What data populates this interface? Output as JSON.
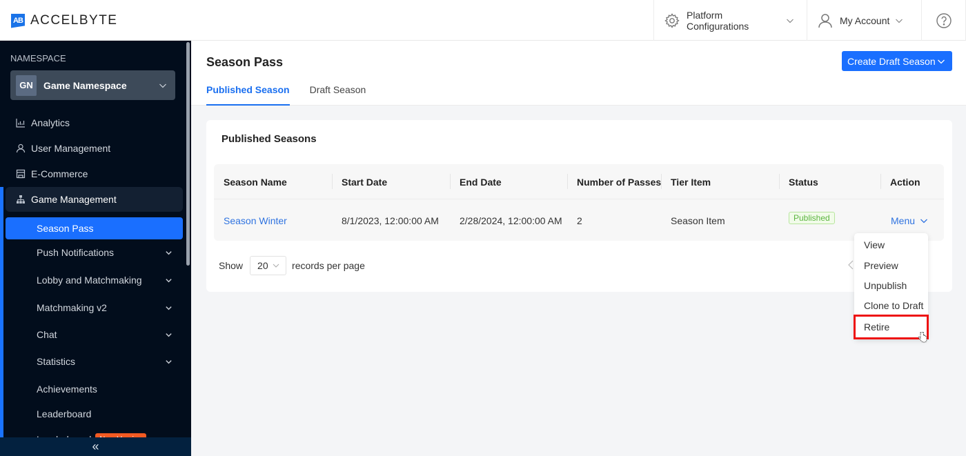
{
  "header": {
    "logo_mark": "AB",
    "logo_text": "ACCELBYTE",
    "platform_config_label": "Platform Configurations",
    "my_account_label": "My Account",
    "help_icon": "question-circle-icon"
  },
  "sidebar": {
    "namespace_label": "NAMESPACE",
    "namespace_avatar": "GN",
    "namespace_name": "Game Namespace",
    "top_items": [
      {
        "label": "Analytics",
        "icon": "bar-chart-icon"
      },
      {
        "label": "User Management",
        "icon": "user-icon"
      },
      {
        "label": "E-Commerce",
        "icon": "store-icon"
      },
      {
        "label": "Game Management",
        "icon": "hierarchy-icon"
      }
    ],
    "active_item": "Season Pass",
    "sub_items": [
      {
        "label": "Push Notifications",
        "expandable": true
      },
      {
        "label": "Lobby and Matchmaking",
        "expandable": true
      },
      {
        "label": "Matchmaking v2",
        "expandable": true
      },
      {
        "label": "Chat",
        "expandable": true
      },
      {
        "label": "Statistics",
        "expandable": true
      },
      {
        "label": "Achievements",
        "expandable": false
      },
      {
        "label": "Leaderboard",
        "expandable": false
      },
      {
        "label": "Leaderboard",
        "expandable": false,
        "badge": "New Version"
      }
    ],
    "collapse_icon": "double-chevron-left-icon"
  },
  "main": {
    "page_title": "Season Pass",
    "tabs": [
      {
        "label": "Published Season",
        "active": true
      },
      {
        "label": "Draft Season",
        "active": false
      }
    ],
    "create_button_label": "Create Draft Season",
    "card_title": "Published Seasons",
    "table": {
      "columns": [
        "Season Name",
        "Start Date",
        "End Date",
        "Number of Passes",
        "Tier Item",
        "Status",
        "Action"
      ],
      "rows": [
        {
          "season_name": "Season Winter",
          "start_date": "8/1/2023, 12:00:00 AM",
          "end_date": "2/28/2024, 12:00:00 AM",
          "number_of_passes": "2",
          "tier_item": "Season Item",
          "status": "Published",
          "action": "Menu"
        }
      ]
    },
    "pagination": {
      "show_label": "Show",
      "page_size": "20",
      "records_label": "records per page"
    },
    "action_menu": {
      "items": [
        "View",
        "Preview",
        "Unpublish",
        "Clone to Draft",
        "Retire"
      ],
      "highlighted": "Retire"
    }
  },
  "colors": {
    "accent": "#1a6fff",
    "sidebar_bg": "#020d1c",
    "status_published": "#5cb540",
    "highlight_box": "#e11111",
    "badge_new": "#f25a22"
  }
}
